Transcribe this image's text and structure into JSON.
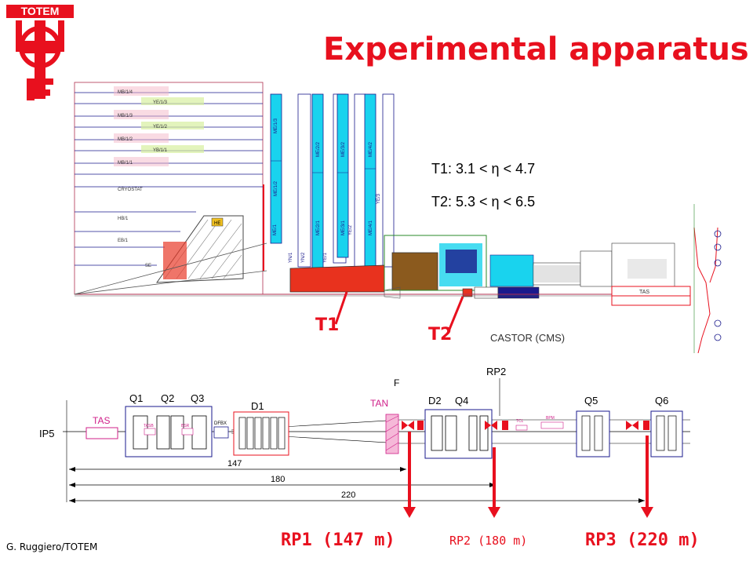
{
  "logo": {
    "text": "TOTEM"
  },
  "title": "Experimental apparatus",
  "ranges": {
    "t1": {
      "prefix": "T1: 3.1 < ",
      "symbol": "η",
      "suffix": " < 4.7"
    },
    "t2": {
      "prefix": "T2: 5.3 < ",
      "symbol": "η",
      "suffix": " < 6.5"
    }
  },
  "detector_labels": [
    "MB/1/4",
    "YE/1/3",
    "MB/1/3",
    "YE/1/2",
    "MB/1/2",
    "YB/1/1",
    "MB/1/1",
    "CRYOSTAT",
    "HB/1",
    "EB/1",
    "SE",
    "HE",
    "ME/1",
    "YN/1",
    "YN/2",
    "ME/1/2",
    "ME/1/3",
    "YE/1",
    "ME/2/2",
    "ME/2/1",
    "YE/2",
    "ME/3/2",
    "ME/3/1",
    "YE/3",
    "ME/4/2",
    "ME/4/1",
    "TAS"
  ],
  "callouts": {
    "t1": "T1",
    "t2": "T2",
    "castor": "CASTOR (CMS)"
  },
  "beamline": {
    "ip": "IP5",
    "magnets": [
      "Q1",
      "Q2",
      "Q3",
      "D1",
      "D2",
      "Q4",
      "Q5",
      "Q6"
    ],
    "elements": [
      "TAS",
      "TAN",
      "DFBX",
      "TASA",
      "TASB",
      "BSR",
      "TCL",
      "BPM"
    ],
    "rp_top": "RP2",
    "fragment": "F",
    "distances": [
      "147",
      "180",
      "220"
    ]
  },
  "roman_pots": {
    "rp1": "RP1 (147 m)",
    "rp2": "RP2 (180 m)",
    "rp3": "RP3 (220 m)"
  },
  "credit": "G. Ruggiero/TOTEM",
  "colors": {
    "accent": "#e8101e",
    "cyan": "#19d3ee",
    "navy": "#1a1a8c",
    "brown": "#8b5a1e",
    "red_block": "#e8321e"
  }
}
